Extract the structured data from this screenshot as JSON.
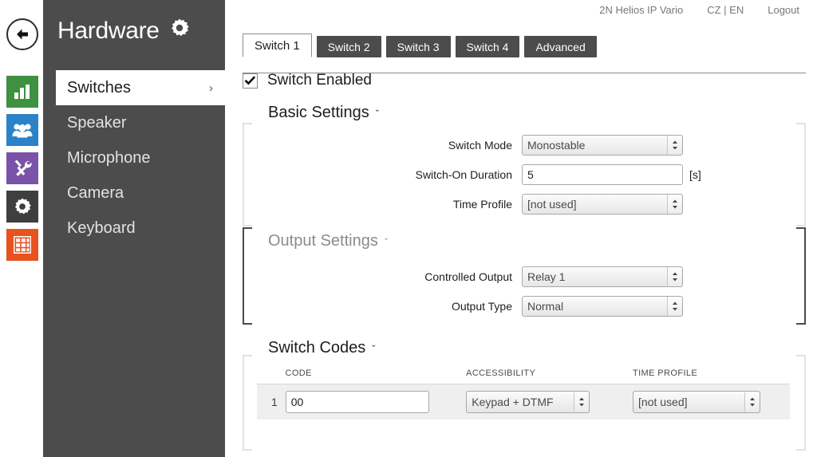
{
  "topbar": {
    "device": "2N Helios IP Vario",
    "language": "CZ | EN",
    "logout": "Logout"
  },
  "sidebar": {
    "title": "Hardware",
    "title_icon": "gear-icon",
    "back_icon": "back-arrow-icon",
    "rail_icons": [
      {
        "name": "status-bar-chart-icon",
        "color": "#3d9140"
      },
      {
        "name": "directory-users-icon",
        "color": "#2b82c9"
      },
      {
        "name": "hardware-tools-icon",
        "color": "#7a52a8"
      },
      {
        "name": "services-gear-icon",
        "color": "#3f3f3f"
      },
      {
        "name": "keypad-grid-icon",
        "color": "#e8521f"
      }
    ],
    "items": [
      {
        "label": "Switches",
        "active": true,
        "chevron": "›"
      },
      {
        "label": "Speaker",
        "active": false,
        "chevron": ""
      },
      {
        "label": "Microphone",
        "active": false,
        "chevron": ""
      },
      {
        "label": "Camera",
        "active": false,
        "chevron": ""
      },
      {
        "label": "Keyboard",
        "active": false,
        "chevron": ""
      }
    ]
  },
  "main": {
    "tabs": [
      {
        "label": "Switch 1",
        "active": true
      },
      {
        "label": "Switch 2",
        "active": false
      },
      {
        "label": "Switch 3",
        "active": false
      },
      {
        "label": "Switch 4",
        "active": false
      },
      {
        "label": "Advanced",
        "active": false
      }
    ],
    "switch_enabled": {
      "label": "Switch Enabled",
      "checked": true
    },
    "basic_settings": {
      "heading": "Basic Settings",
      "caret": "ˇ",
      "fields": [
        {
          "label": "Switch Mode",
          "value": "Monostable",
          "type": "select"
        },
        {
          "label": "Switch-On Duration",
          "value": "5",
          "type": "input",
          "unit": "[s]"
        },
        {
          "label": "Time Profile",
          "value": "[not used]",
          "type": "select"
        }
      ]
    },
    "output_settings": {
      "heading": "Output Settings",
      "caret": "ˇ",
      "fields": [
        {
          "label": "Controlled Output",
          "value": "Relay 1",
          "type": "select"
        },
        {
          "label": "Output Type",
          "value": "Normal",
          "type": "select"
        }
      ]
    },
    "switch_codes": {
      "heading": "Switch Codes",
      "caret": "ˇ",
      "columns": [
        "CODE",
        "ACCESSIBILITY",
        "TIME PROFILE"
      ],
      "rows": [
        {
          "num": "1",
          "code": "00",
          "accessibility": "Keypad + DTMF",
          "time_profile": "[not used]"
        }
      ]
    }
  }
}
